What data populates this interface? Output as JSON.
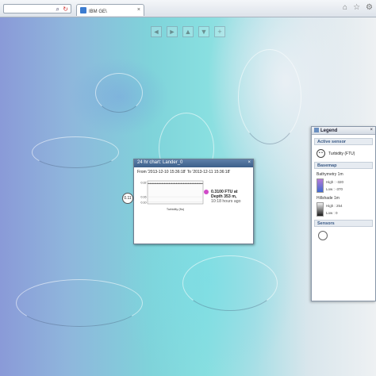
{
  "browser": {
    "tab_title": "IBM GE\\",
    "search_glyph": "⌕",
    "reload_glyph": "↻",
    "close_glyph": "×",
    "toolbar_glyphs": [
      "⌂",
      "☆",
      "⚙"
    ]
  },
  "map_controls": [
    "◄",
    "►",
    "▲",
    "▼",
    "+"
  ],
  "marker": {
    "label": "0.11"
  },
  "popup": {
    "title": "24 hr chart: Lander_0",
    "close": "×",
    "range_text": "From '2013-12-10 15:36:18' To '2013-12-11 15:36:18'",
    "reading_line1": "0.3100 FTU at",
    "reading_line2": "Depth 353 m,",
    "reading_line3": "10:18 hours ago"
  },
  "chart_data": {
    "type": "line",
    "title": "",
    "xlabel": "Turbidity (ftu)",
    "ylabel": "",
    "yticks": [
      "0.32",
      "0.16",
      "0.10"
    ],
    "ylim": [
      0.08,
      0.34
    ],
    "series": [
      {
        "values": [
          0.31,
          0.31,
          0.31,
          0.31,
          0.31,
          0.31,
          0.31,
          0.31,
          0.31,
          0.31,
          0.31,
          0.31,
          0.31,
          0.31,
          0.31,
          0.31,
          0.31,
          0.31,
          0.31,
          0.31,
          0.31,
          0.31,
          0.31,
          0.31
        ]
      }
    ],
    "colors": {
      "line": "#555555",
      "marker": "#d04ac8"
    }
  },
  "legend": {
    "title": "Legend",
    "close": "×",
    "active_sensor_header": "Active sensor",
    "active_sensor_name": "Turbidity (FTU)",
    "basemap_header": "Basemap",
    "bathymetry_label": "Bathymetry 1m",
    "bathymetry_high": "High : -320",
    "bathymetry_low": "Low : -370",
    "hillshade_label": "Hillshade 1m",
    "hillshade_high": "High : 254",
    "hillshade_low": "Low : 0",
    "sensors_header": "Sensors"
  },
  "colors": {
    "bathymetry_gradient": [
      "#b47ad8",
      "#3f6bd0"
    ],
    "hillshade_gradient": [
      "#f2f2f2",
      "#1a1a1a"
    ],
    "accent": "#3c5f8a"
  }
}
